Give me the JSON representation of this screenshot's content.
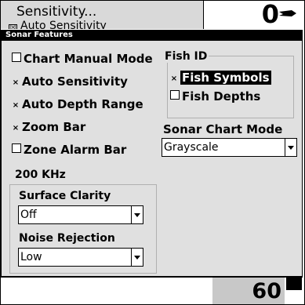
{
  "background_menu": {
    "line1": "Sensitivity...",
    "line2": "Auto Sensitivity",
    "line2_check": "☒",
    "depth_value": "0"
  },
  "dialog": {
    "title": "Sonar Features",
    "options": {
      "chart_manual_mode": {
        "label": "Chart Manual Mode",
        "check": ""
      },
      "auto_sensitivity": {
        "label": "Auto Sensitivity",
        "check": "×"
      },
      "auto_depth_range": {
        "label": "Auto Depth Range",
        "check": "×"
      },
      "zoom_bar": {
        "label": "Zoom Bar",
        "check": "×"
      },
      "zone_alarm_bar": {
        "label": "Zone Alarm Bar",
        "check": ""
      }
    },
    "fish_id": {
      "label": "Fish ID",
      "fish_symbols": {
        "label": "Fish Symbols",
        "check": "×"
      },
      "fish_depths": {
        "label": "Fish Depths",
        "check": ""
      }
    },
    "sonar_chart_mode": {
      "label": "Sonar Chart Mode",
      "value": "Grayscale"
    },
    "hz_group": {
      "label": "200 KHz",
      "surface_clarity": {
        "label": "Surface Clarity",
        "value": "Off"
      },
      "noise_rejection": {
        "label": "Noise Rejection",
        "value": "Low"
      }
    }
  },
  "bottom": {
    "depth_value": "60"
  }
}
